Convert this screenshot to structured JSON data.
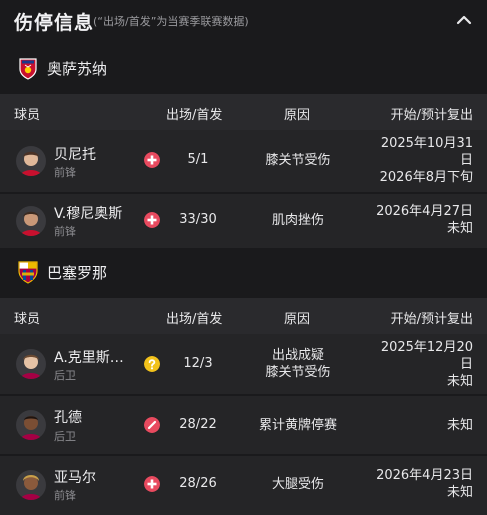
{
  "header": {
    "title": "伤停信息",
    "subtitle": "(“出场/首发”为当赛季联赛数据)"
  },
  "columns": {
    "player": "球员",
    "apps": "出场/首发",
    "reason": "原因",
    "dates": "开始/预计复出"
  },
  "teams": [
    {
      "name": "奥萨苏纳",
      "players": [
        {
          "name": "贝尼托",
          "position": "前锋",
          "apps": "5/1",
          "reason": "膝关节受伤",
          "date_line1": "2025年10月31",
          "date_line2": "日",
          "date_line3": "2026年8月下旬",
          "status": "injury"
        },
        {
          "name": "V.穆尼奥斯",
          "position": "前锋",
          "apps": "33/30",
          "reason": "肌肉挫伤",
          "date_line1": "2026年4月27日",
          "date_line2": "未知",
          "status": "injury"
        }
      ]
    },
    {
      "name": "巴塞罗那",
      "players": [
        {
          "name": "A.克里斯…",
          "position": "后卫",
          "apps": "12/3",
          "reason_line1": "出战成疑",
          "reason_line2": "膝关节受伤",
          "date_line1": "2025年12月20",
          "date_line2": "日",
          "date_line3": "未知",
          "status": "doubtful"
        },
        {
          "name": "孔德",
          "position": "后卫",
          "apps": "28/22",
          "reason": "累计黄牌停赛",
          "date_line1": "未知",
          "status": "suspended"
        },
        {
          "name": "亚马尔",
          "position": "前锋",
          "apps": "28/26",
          "reason": "大腿受伤",
          "date_line1": "2026年4月23日",
          "date_line2": "未知",
          "status": "injury"
        }
      ]
    }
  ],
  "colors": {
    "injury": "#e84a5f",
    "doubtful": "#f2c21b",
    "suspended": "#e84a5f"
  }
}
